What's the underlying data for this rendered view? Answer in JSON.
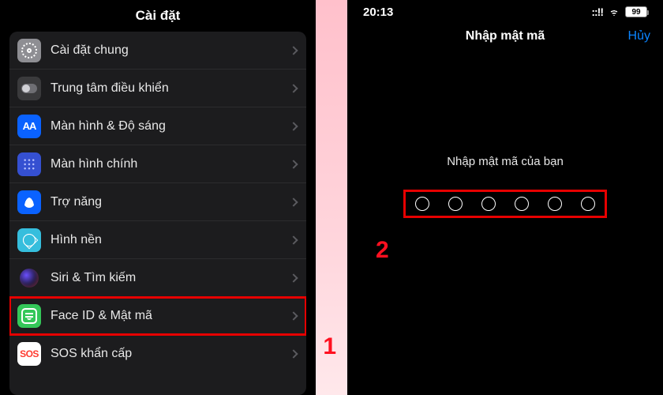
{
  "left": {
    "title": "Cài đặt",
    "items": [
      {
        "key": "general",
        "label": "Cài đặt chung",
        "icon_name": "gear-icon",
        "icon_class": "ic-general"
      },
      {
        "key": "control-center",
        "label": "Trung tâm điều khiển",
        "icon_name": "switch-icon",
        "icon_class": "ic-control"
      },
      {
        "key": "display",
        "label": "Màn hình & Độ sáng",
        "icon_name": "text-size-icon",
        "icon_class": "ic-display"
      },
      {
        "key": "home-screen",
        "label": "Màn hình chính",
        "icon_name": "app-grid-icon",
        "icon_class": "ic-home"
      },
      {
        "key": "accessibility",
        "label": "Trợ năng",
        "icon_name": "accessibility-icon",
        "icon_class": "ic-access"
      },
      {
        "key": "wallpaper",
        "label": "Hình nền",
        "icon_name": "flower-icon",
        "icon_class": "ic-wall"
      },
      {
        "key": "siri",
        "label": "Siri & Tìm kiếm",
        "icon_name": "siri-icon",
        "icon_class": "ic-siri"
      },
      {
        "key": "face-id",
        "label": "Face ID & Mật mã",
        "icon_name": "face-id-icon",
        "icon_class": "ic-face",
        "highlight": true
      },
      {
        "key": "sos",
        "label": "SOS khẩn cấp",
        "icon_name": "sos-icon",
        "icon_class": "ic-sos"
      }
    ],
    "step_marker": "1"
  },
  "right": {
    "status_bar": {
      "time": "20:13",
      "battery": "99"
    },
    "title": "Nhập mật mã",
    "cancel_label": "Hủy",
    "prompt": "Nhập mật mã của bạn",
    "passcode_length": 6,
    "step_marker": "2"
  },
  "colors": {
    "highlight": "#e60000",
    "link": "#0a84ff"
  }
}
